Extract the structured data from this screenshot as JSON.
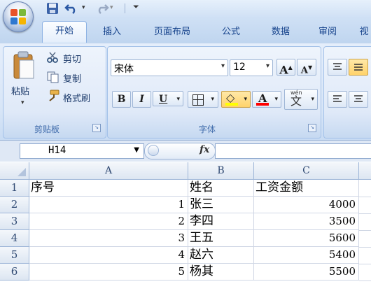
{
  "qat": {
    "undo_icon": "undo-icon",
    "redo_icon": "redo-icon",
    "save_icon": "save-icon",
    "customize_icon": "qat-customize-icon"
  },
  "tabs": [
    {
      "label": "开始",
      "active": true
    },
    {
      "label": "插入"
    },
    {
      "label": "页面布局"
    },
    {
      "label": "公式"
    },
    {
      "label": "数据"
    },
    {
      "label": "审阅"
    },
    {
      "label": "视"
    }
  ],
  "clipboard": {
    "paste_label": "粘贴",
    "cut_label": "剪切",
    "copy_label": "复制",
    "format_painter_label": "格式刷",
    "group_label": "剪贴板"
  },
  "font": {
    "font_name": "宋体",
    "font_size": "12",
    "grow_label": "A",
    "shrink_label": "A",
    "bold_label": "B",
    "italic_label": "I",
    "underline_label": "U",
    "fill_color_label": "◇",
    "font_color_label": "A",
    "phonetic_label": "文",
    "phonetic_top": "wén",
    "group_label": "字体",
    "accent_fill": "#ffff00",
    "accent_font": "#ff0000"
  },
  "formula_bar": {
    "name_box": "H14",
    "fx_label": "fx",
    "formula": ""
  },
  "sheet": {
    "columns": [
      "A",
      "B",
      "C"
    ],
    "rows": [
      {
        "row": "1",
        "a": "序号",
        "b": "姓名",
        "c": "工资金额"
      },
      {
        "row": "2",
        "a": "1",
        "b": "张三",
        "c": "4000"
      },
      {
        "row": "3",
        "a": "2",
        "b": "李四",
        "c": "3500"
      },
      {
        "row": "4",
        "a": "3",
        "b": "王五",
        "c": "5600"
      },
      {
        "row": "5",
        "a": "4",
        "b": "赵六",
        "c": "5400"
      },
      {
        "row": "6",
        "a": "5",
        "b": "杨其",
        "c": "5500"
      }
    ]
  }
}
